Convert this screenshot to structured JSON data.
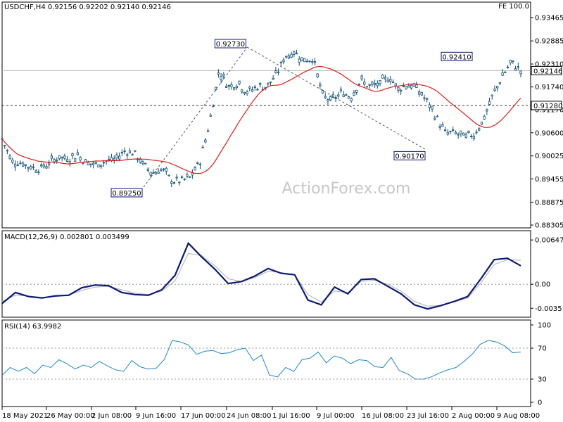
{
  "chart_data": [
    {
      "type": "candlestick",
      "title": "USDCHF,H4  0.92156 0.92202 0.92140 0.92146",
      "corner_label": "FE 100.0",
      "watermark": "ActionForex.com",
      "ylim": [
        0.88305,
        0.93465
      ],
      "y_ticks": [
        "0.93465",
        "0.92885",
        "0.92310",
        "0.91740",
        "0.91170",
        "0.90600",
        "0.90025",
        "0.89455",
        "0.88875",
        "0.88305"
      ],
      "current_price": "0.92146",
      "support_level": "0.91280",
      "resistance_level": "0.92146",
      "price_path": [
        [
          0,
          0.9045
        ],
        [
          1,
          0.899
        ],
        [
          2,
          0.8985
        ],
        [
          3,
          0.8975
        ],
        [
          4,
          0.897
        ],
        [
          5,
          0.8985
        ],
        [
          6,
          0.9
        ],
        [
          7,
          0.8995
        ],
        [
          8,
          0.9005
        ],
        [
          9,
          0.8985
        ],
        [
          10,
          0.898
        ],
        [
          11,
          0.899
        ],
        [
          12,
          0.8993
        ],
        [
          13,
          0.9015
        ],
        [
          14,
          0.901
        ],
        [
          15,
          0.898
        ],
        [
          16,
          0.896
        ],
        [
          17,
          0.897
        ],
        [
          18,
          0.894
        ],
        [
          19,
          0.894
        ],
        [
          20,
          0.895
        ],
        [
          21,
          0.899
        ],
        [
          22,
          0.9085
        ],
        [
          23,
          0.9215
        ],
        [
          24,
          0.9175
        ],
        [
          25,
          0.9185
        ],
        [
          26,
          0.916
        ],
        [
          27,
          0.9175
        ],
        [
          28,
          0.9175
        ],
        [
          29,
          0.92
        ],
        [
          30,
          0.925
        ],
        [
          31,
          0.926
        ],
        [
          32,
          0.924
        ],
        [
          33,
          0.9245
        ],
        [
          34,
          0.915
        ],
        [
          35,
          0.914
        ],
        [
          36,
          0.916
        ],
        [
          37,
          0.915
        ],
        [
          38,
          0.919
        ],
        [
          39,
          0.9175
        ],
        [
          40,
          0.918
        ],
        [
          41,
          0.92
        ],
        [
          42,
          0.917
        ],
        [
          43,
          0.918
        ],
        [
          44,
          0.917
        ],
        [
          45,
          0.914
        ],
        [
          46,
          0.91
        ],
        [
          47,
          0.906
        ],
        [
          48,
          0.906
        ],
        [
          49,
          0.905
        ],
        [
          50,
          0.9055
        ],
        [
          51,
          0.909
        ],
        [
          52,
          0.915
        ],
        [
          53,
          0.92
        ],
        [
          54,
          0.9235
        ],
        [
          55,
          0.9215
        ]
      ],
      "swing_labels": [
        {
          "label": "0.92730",
          "t": 26,
          "price": 0.9273
        },
        {
          "label": "0.89250",
          "t": 15,
          "price": 0.8925
        },
        {
          "label": "0.90170",
          "t": 45,
          "price": 0.9017
        },
        {
          "label": "0.92410",
          "t": 50,
          "price": 0.9241
        }
      ],
      "x_ticks": [
        "18 May 2021",
        "26 May 00:00",
        "2 Jun 08:00",
        "9 Jun 16:00",
        "17 Jun 00:00",
        "24 Jun 08:00",
        "1 Jul 16:00",
        "9 Jul 00:00",
        "16 Jul 08:00",
        "23 Jul 16:00",
        "2 Aug 00:00",
        "9 Aug 08:00"
      ],
      "colors": {
        "moving_average": "#e31b1b",
        "candles": "#0a4d74",
        "trendline": "#555555"
      }
    },
    {
      "type": "line",
      "title": "MACD(12,26,9) 0.002801 0.003499",
      "ylim": [
        -0.0045,
        0.0068
      ],
      "y_ticks": [
        "0.006473",
        "0.00",
        "-0.0035"
      ],
      "series": [
        {
          "values": [
            -0.0028,
            -0.0012,
            -0.0018,
            -0.002,
            -0.0017,
            -0.0016,
            -0.0005,
            -0.0001,
            -0.0002,
            -0.0012,
            -0.0015,
            -0.0016,
            -0.0008,
            0.0013,
            0.006,
            0.004,
            0.0022,
            0.0001,
            0.0004,
            0.0012,
            0.0023,
            0.0016,
            0.0014,
            -0.0023,
            -0.003,
            -0.0004,
            -0.0014,
            0.0007,
            0.0008,
            -0.0003,
            -0.0014,
            -0.003,
            -0.0036,
            -0.0031,
            -0.0025,
            -0.0018,
            0.0008,
            0.0036,
            0.0038,
            0.0027
          ]
        },
        {
          "values": [
            -0.0025,
            -0.0016,
            -0.0017,
            -0.0019,
            -0.0018,
            -0.0016,
            -0.0009,
            -0.0004,
            -0.0003,
            -0.0008,
            -0.0013,
            -0.0015,
            -0.001,
            0.0005,
            0.0045,
            0.0042,
            0.0027,
            0.0008,
            0.0004,
            0.001,
            0.0019,
            0.0017,
            0.0014,
            -0.0015,
            -0.0026,
            -0.001,
            -0.0012,
            0.0004,
            0.0006,
            0.0,
            -0.001,
            -0.0025,
            -0.0032,
            -0.0031,
            -0.0026,
            -0.002,
            0.0002,
            0.0029,
            0.0036,
            0.0035
          ]
        }
      ],
      "colors": {
        "macd": "#0a1a78",
        "signal": "#b0b0b0"
      }
    },
    {
      "type": "line",
      "title": "RSI(14) 63.9982",
      "ylim": [
        0,
        100
      ],
      "y_ticks": [
        "100",
        "70",
        "30",
        "0"
      ],
      "levels": [
        70,
        30
      ],
      "series": [
        {
          "values": [
            35,
            45,
            40,
            45,
            37,
            48,
            45,
            55,
            50,
            43,
            48,
            45,
            53,
            47,
            42,
            40,
            54,
            46,
            43,
            44,
            55,
            80,
            78,
            74,
            62,
            66,
            67,
            63,
            64,
            68,
            70,
            54,
            61,
            35,
            33,
            45,
            40,
            55,
            57,
            65,
            51,
            60,
            57,
            50,
            55,
            54,
            46,
            45,
            58,
            41,
            37,
            30,
            30,
            33,
            38,
            42,
            45,
            53,
            62,
            75,
            80,
            78,
            73,
            64,
            65
          ]
        }
      ],
      "colors": {
        "rsi": "#1e88c8"
      }
    }
  ]
}
